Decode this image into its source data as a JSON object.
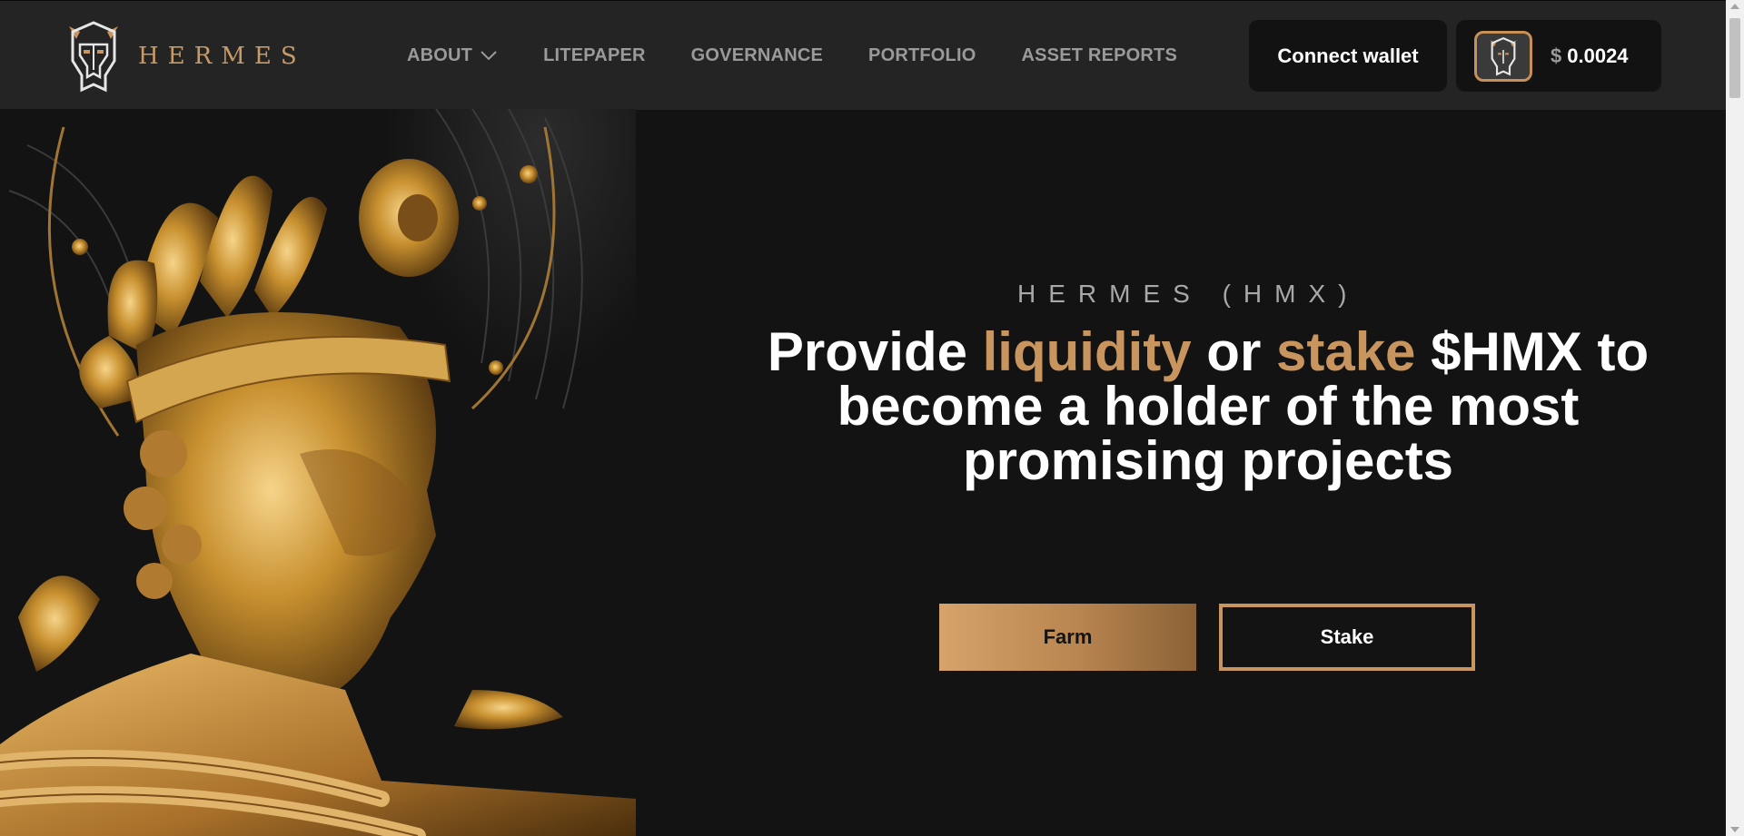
{
  "header": {
    "logo_text": "HERMES",
    "nav": [
      {
        "label": "ABOUT",
        "has_dropdown": true
      },
      {
        "label": "LITEPAPER"
      },
      {
        "label": "GOVERNANCE"
      },
      {
        "label": "PORTFOLIO"
      },
      {
        "label": "ASSET REPORTS"
      }
    ],
    "connect_wallet_label": "Connect wallet",
    "token_price": {
      "currency_symbol": "$",
      "value": "0.0024",
      "icon": "hermes-helmet-icon"
    }
  },
  "hero": {
    "eyebrow": "HERMES (HMX)",
    "headline": {
      "part1": "Provide ",
      "accent1": "liquidity",
      "part2": " or ",
      "accent2": "stake",
      "part3": " $HMX to become a holder of the most promising projects"
    },
    "buttons": {
      "farm_label": "Farm",
      "stake_label": "Stake"
    },
    "image": "golden-hermes-statue"
  },
  "colors": {
    "background": "#131313",
    "header_bg": "#242424",
    "accent_gold": "#c8955f",
    "nav_text": "#9a9a9a",
    "text_white": "#ffffff"
  }
}
